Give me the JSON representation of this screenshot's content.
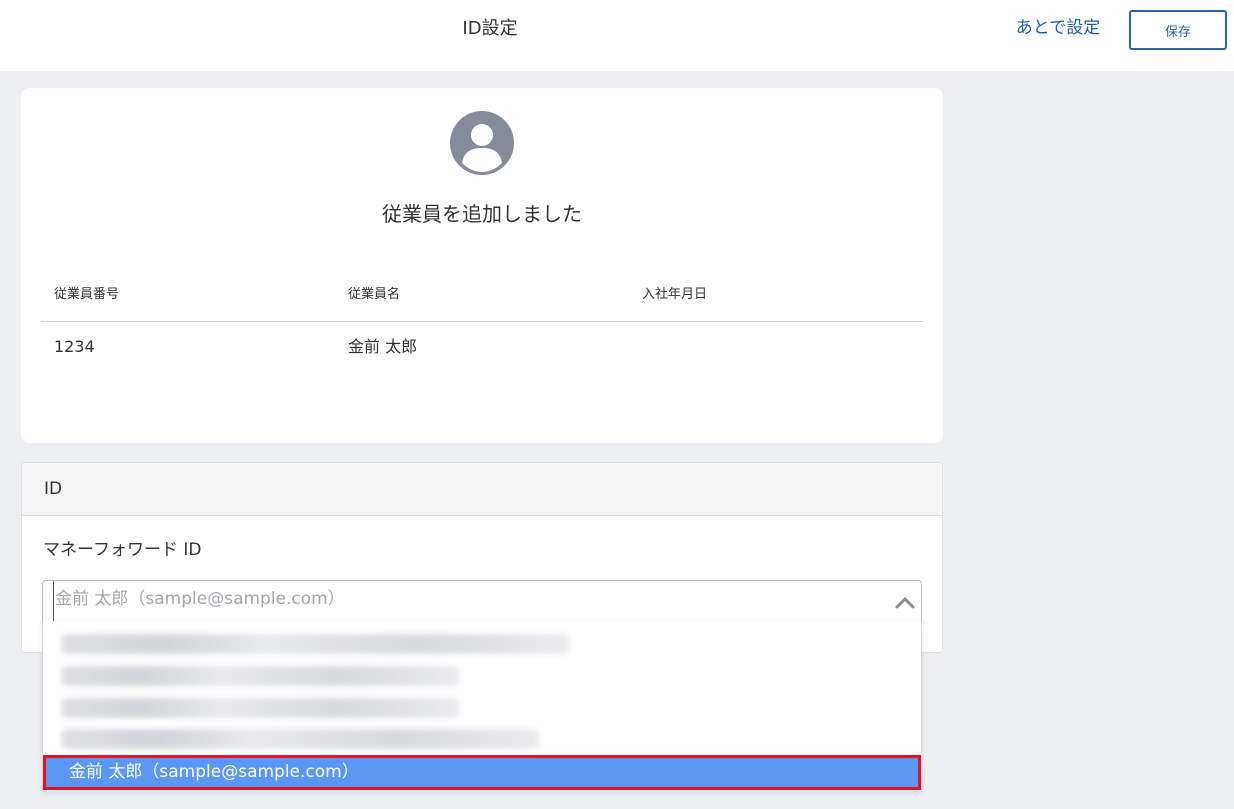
{
  "header": {
    "title": "ID設定",
    "later_label": "あとで設定",
    "save_label": "保存"
  },
  "employee_card": {
    "avatar_icon": "user-circle-icon",
    "heading": "従業員を追加しました",
    "columns": [
      "従業員番号",
      "従業員名",
      "入社年月日"
    ],
    "row": {
      "employee_number": "1234",
      "employee_name": "金前 太郎",
      "join_date": ""
    }
  },
  "id_panel": {
    "header": "ID",
    "field_label": "マネーフォワード ID",
    "select": {
      "placeholder": "金前 太郎（sample@sample.com）",
      "chevron_icon": "chevron-up-icon"
    },
    "dropdown": {
      "selected_option": "金前 太郎（sample@sample.com）"
    }
  },
  "colors": {
    "accent": "#2a63ad",
    "selected_bg": "#5b97f5",
    "highlight_border": "#e81022"
  }
}
